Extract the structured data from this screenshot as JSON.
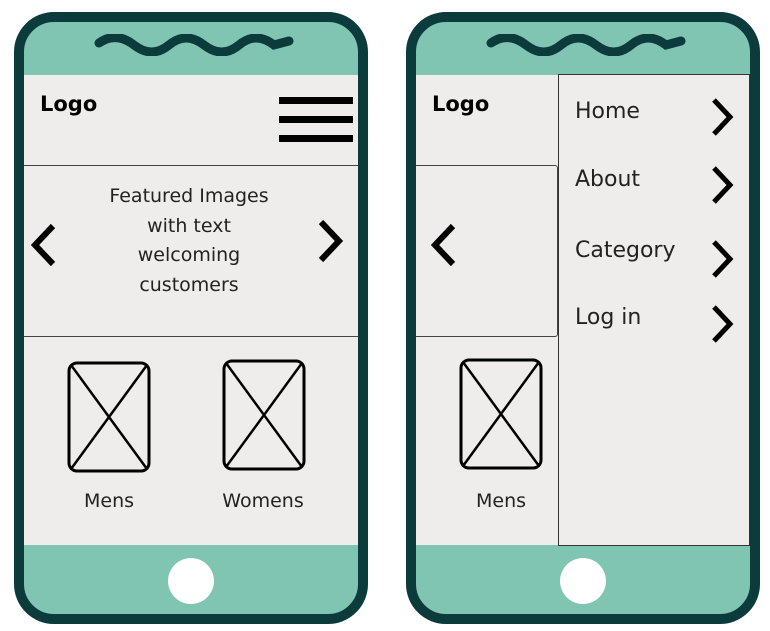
{
  "left_phone": {
    "logo": "Logo",
    "carousel_text": [
      "Featured Images",
      "with text",
      "welcoming",
      "customers"
    ],
    "products": [
      {
        "label": "Mens"
      },
      {
        "label": "Womens"
      }
    ]
  },
  "right_phone": {
    "logo": "Logo",
    "products": [
      {
        "label": "Mens"
      }
    ],
    "menu": [
      {
        "label": "Home"
      },
      {
        "label": "About"
      },
      {
        "label": "Category"
      },
      {
        "label": "Log in"
      }
    ]
  },
  "colors": {
    "frame": "#0b3b3a",
    "accent": "#7fc5b2",
    "screen": "#eeedeb"
  }
}
